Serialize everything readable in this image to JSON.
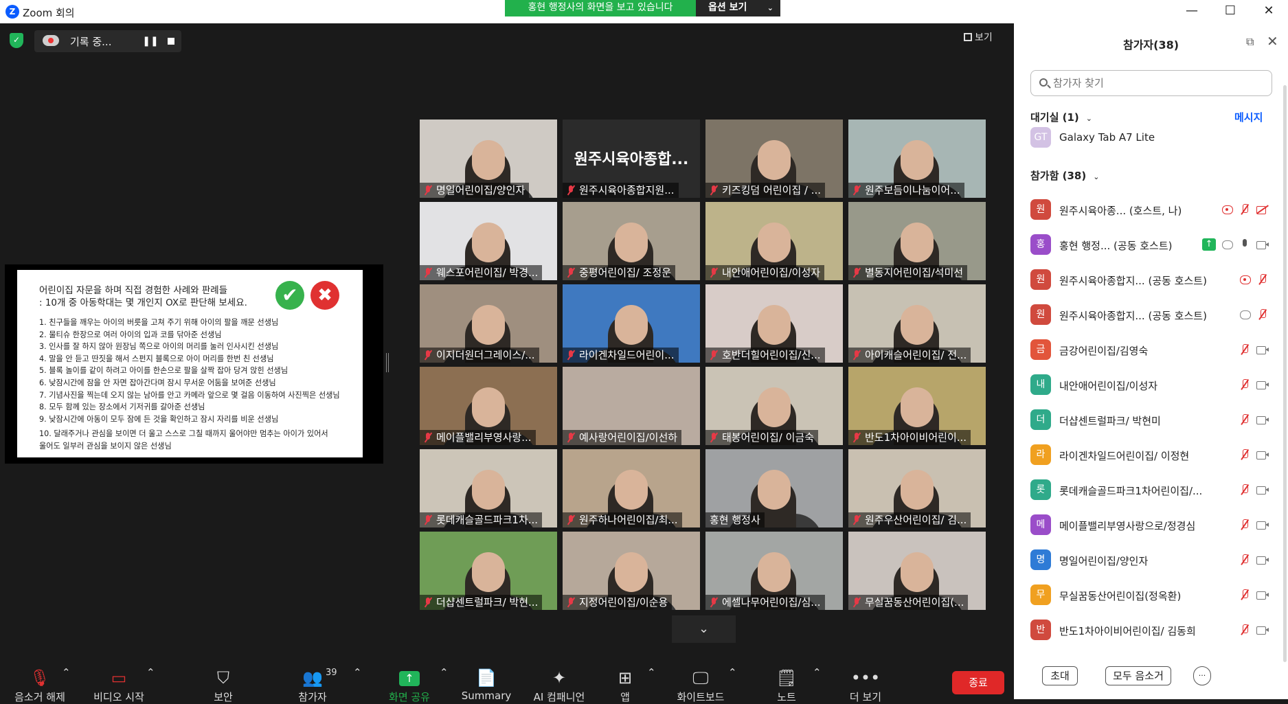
{
  "window": {
    "title": "Zoom 회의",
    "minimize": "—",
    "maximize": "☐",
    "close": "✕"
  },
  "share_banner": {
    "text": "홍현 행정사의 화면을 보고 있습니다",
    "options_label": "옵션 보기",
    "options_chevron": "⌄"
  },
  "meeting": {
    "recording_label": "기록 중...",
    "pause_icon": "❚❚",
    "view_label": "보기",
    "scroll_down": "⌄"
  },
  "slide": {
    "heading1": "어린이집 자문을 하며 직접 경험한 사례와 판례들",
    "heading2": ": 10개 중 아동학대는 몇 개인지 OX로 판단해 보세요.",
    "ok_mark": "✔",
    "x_mark": "✖",
    "items": [
      "1. 친구들을 깨우는 아이의 버릇을 고쳐 주기 위해 아이의 팔을 깨문 선생님",
      "2. 물티슈 한장으로 여러 아이의 입과 코를 닦아준 선생님",
      "3. 인사를 잘 하지 않아 원장님 쪽으로 아이의 머리를 눌러 인사시킨 선생님",
      "4. 말을 안 듣고 딴짓을 해서 스펀지 블록으로 아이 머리를 한번 친 선생님",
      "5. 블록 놀이를 같이 하려고 아이를 한손으로 팔을 살짝 잡아 당겨 앉힌 선생님",
      "6. 낮잠시간에 잠을 안 자면 잡아간다며 잠시 무서운 어둠을 보여준 선생님",
      "7. 기념사진을 찍는데 오지 않는 남아를 안고 카메라 앞으로 몇 걸음 이동하여 사진찍은 선생님",
      "8. 모두 함께 있는 장소에서 기저귀를 갈아준 선생님",
      "9. 낮잠시간에 아동이 모두 잠에 든 것을 확인하고 잠시 자리를 비운 선생님",
      "10. 달래주거나 관심을 보이면 더 울고 스스로 그칠 때까지 울어야만 멈추는 아이가 있어서",
      "울어도 일부러 관심을 보이지 않은 선생님"
    ]
  },
  "tiles": [
    {
      "name": "명일어린이집/양인자",
      "muted": true,
      "bg": "#cfcac4",
      "kind": "person"
    },
    {
      "name": "원주시육아종합지원...",
      "muted": true,
      "bg": "#2b2b2b",
      "kind": "nameonly",
      "big": "원주시육아종합..."
    },
    {
      "name": "키즈킹덤 어린이집 / ...",
      "muted": true,
      "bg": "#7d7466",
      "kind": "person"
    },
    {
      "name": "원주보듬이나눔이어...",
      "muted": true,
      "bg": "#a7b6b4",
      "kind": "person"
    },
    {
      "name": "웨스포어린이집/ 박경...",
      "muted": true,
      "bg": "#e2e2e4",
      "kind": "person"
    },
    {
      "name": "중평어린이집/ 조정운",
      "muted": true,
      "bg": "#a79e8e",
      "kind": "person"
    },
    {
      "name": "내안애어린이집/이성자",
      "muted": true,
      "bg": "#bdb38a",
      "kind": "person"
    },
    {
      "name": "별동지어린이집/석미선",
      "muted": true,
      "bg": "#98998a",
      "kind": "person"
    },
    {
      "name": "이지더원더그레이스/...",
      "muted": true,
      "bg": "#9f8f7f",
      "kind": "person"
    },
    {
      "name": "라이겐차일드어린이...",
      "muted": true,
      "bg": "#3f79c0",
      "kind": "person"
    },
    {
      "name": "호반더힐어린이집/신...",
      "muted": true,
      "bg": "#d8ccc8",
      "kind": "person"
    },
    {
      "name": "아이캐슬어린이집/ 전...",
      "muted": true,
      "bg": "#c7c1b3",
      "kind": "person"
    },
    {
      "name": "메이플밸리부영사랑...",
      "muted": true,
      "bg": "#8c6f52",
      "kind": "person"
    },
    {
      "name": "예사랑어린이집/이선하",
      "muted": true,
      "bg": "#b9aba0",
      "kind": "blank"
    },
    {
      "name": "태봉어린이집/ 이금숙",
      "muted": true,
      "bg": "#cac3b5",
      "kind": "person"
    },
    {
      "name": "반도1차아이비어린이...",
      "muted": true,
      "bg": "#b7a56a",
      "kind": "person"
    },
    {
      "name": "롯데캐슬골드파크1차...",
      "muted": true,
      "bg": "#ccc5b8",
      "kind": "person"
    },
    {
      "name": "원주하나어린이집/최...",
      "muted": true,
      "bg": "#b8a48c",
      "kind": "person"
    },
    {
      "name": "홍현 행정사",
      "muted": false,
      "bg": "#9fa1a3",
      "kind": "person",
      "active": true
    },
    {
      "name": "원주우산어린이집/ 김...",
      "muted": true,
      "bg": "#c9c0b1",
      "kind": "person"
    },
    {
      "name": "더샵센트럴파크/ 박현...",
      "muted": true,
      "bg": "#6f9d56",
      "kind": "person"
    },
    {
      "name": "지정어린이집/이순용",
      "muted": true,
      "bg": "#b6a89a",
      "kind": "person"
    },
    {
      "name": "에셀나무어린이집/심...",
      "muted": true,
      "bg": "#a3a6a4",
      "kind": "person"
    },
    {
      "name": "무실꿈동산어린이집(...",
      "muted": true,
      "bg": "#c9c2bd",
      "kind": "person"
    }
  ],
  "toolbar": {
    "mute": {
      "label": "음소거 해제",
      "icon": "microphone-muted-icon"
    },
    "video": {
      "label": "비디오 시작",
      "icon": "camera-off-icon"
    },
    "security": {
      "label": "보안",
      "icon": "shield-icon"
    },
    "participants": {
      "label": "참가자",
      "count": "39",
      "icon": "people-icon"
    },
    "share": {
      "label": "화면 공유",
      "icon": "share-up-arrow-icon"
    },
    "summary": {
      "label": "Summary",
      "icon": "document-sparkle-icon"
    },
    "ai": {
      "label": "AI 컴패니언",
      "icon": "sparkle-icon"
    },
    "apps": {
      "label": "앱",
      "icon": "apps-icon"
    },
    "whiteboard": {
      "label": "화이트보드",
      "icon": "whiteboard-icon"
    },
    "notes": {
      "label": "노트",
      "icon": "notes-icon"
    },
    "more": {
      "label": "더 보기",
      "icon": "ellipsis-icon"
    },
    "end_label": "종료",
    "chevron": "⌃"
  },
  "panel": {
    "title": "참가자(38)",
    "popout": "⧉",
    "close": "✕",
    "search_placeholder": "참가자 찾기",
    "waiting_label": "대기실 (1)",
    "message_label": "메시지",
    "waiting": [
      {
        "initials": "GT",
        "name": "Galaxy Tab A7 Lite",
        "color": "#d3c2e4"
      }
    ],
    "joined_label": "참가함 (38)",
    "chevron": "⌄",
    "participants": [
      {
        "initial": "원",
        "name": "원주시육아종...   (호스트, 나)",
        "color": "#d04a3e",
        "icons": [
          "recdot",
          "mutedmic",
          "camoff"
        ]
      },
      {
        "initial": "홍",
        "name": "홍현 행정... (공동 호스트)",
        "color": "#9a4dc9",
        "icons": [
          "shareup",
          "recgray",
          "mic",
          "cam"
        ]
      },
      {
        "initial": "원",
        "name": "원주시육아종합지... (공동 호스트)",
        "color": "#d04a3e",
        "icons": [
          "recdot",
          "mutedmic"
        ]
      },
      {
        "initial": "원",
        "name": "원주시육아종합지... (공동 호스트)",
        "color": "#d04a3e",
        "icons": [
          "recgray",
          "mutedmic"
        ]
      },
      {
        "initial": "금",
        "name": "금강어린이집/김영숙",
        "color": "#e2553b",
        "icons": [
          "mutedmic",
          "cam"
        ]
      },
      {
        "initial": "내",
        "name": "내안애어린이집/이성자",
        "color": "#2faa8a",
        "icons": [
          "mutedmic",
          "cam"
        ]
      },
      {
        "initial": "더",
        "name": "더샵센트럴파크/ 박현미",
        "color": "#2faa8a",
        "icons": [
          "mutedmic",
          "cam"
        ]
      },
      {
        "initial": "라",
        "name": "라이겐차일드어린이집/ 이정현",
        "color": "#f0a020",
        "icons": [
          "mutedmic",
          "cam"
        ]
      },
      {
        "initial": "롯",
        "name": "롯데캐슬골드파크1차어린이집/...",
        "color": "#2faa8a",
        "icons": [
          "mutedmic",
          "cam"
        ]
      },
      {
        "initial": "메",
        "name": "메이플밸리부영사랑으로/정경심",
        "color": "#9a4dc9",
        "icons": [
          "mutedmic",
          "cam"
        ]
      },
      {
        "initial": "명",
        "name": "명일어린이집/양인자",
        "color": "#2e7bd6",
        "icons": [
          "mutedmic",
          "cam"
        ]
      },
      {
        "initial": "무",
        "name": "무실꿈동산어린이집(정옥환)",
        "color": "#f0a020",
        "icons": [
          "mutedmic",
          "cam"
        ]
      },
      {
        "initial": "반",
        "name": "반도1차아이비어린이집/ 김동희",
        "color": "#d04a3e",
        "icons": [
          "mutedmic",
          "cam"
        ]
      }
    ],
    "invite_label": "초대",
    "mute_all_label": "모두 음소거",
    "more_label": "···"
  }
}
